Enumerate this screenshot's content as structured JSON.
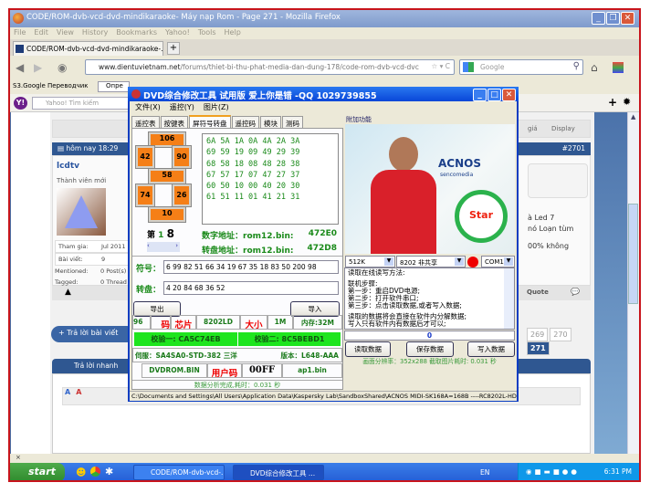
{
  "browser": {
    "title": "CODE/ROM-dvb-vcd-dvd-mindikaraoke- Máy nạp Rom - Page 271 - Mozilla Firefox",
    "menu": [
      "File",
      "Edit",
      "View",
      "History",
      "Bookmarks",
      "Yahoo!",
      "Tools",
      "Help"
    ],
    "tab": "CODE/ROM-dvb-vcd-dvd-mindikaraoke-...",
    "new_tab": "+",
    "url_domain": "www.dientuvietnam.net",
    "url_path": "/forums/thiet-bi-thu-phat-media-dan-dung-178/code-rom-dvb-vcd-dvc",
    "search_placeholder": "Google",
    "bookmark": "S3.Google Переводчик",
    "bookmark2": "Опре",
    "yahoo_logo": "Y!",
    "yahoo_search_placeholder": "Yahoo! Tìm kiếm",
    "status_x": "×"
  },
  "forum": {
    "post_time": "hôm nay 18:29",
    "post_number": "#2701",
    "username": "lcdtv",
    "rank": "Thành viên mới",
    "info": [
      {
        "label": "Tham gia:",
        "value": "Jul 2011"
      },
      {
        "label": "Bài viết:",
        "value": "9"
      },
      {
        "label": "Mentioned:",
        "value": "0 Post(s)"
      },
      {
        "label": "Tagged:",
        "value": "0 Thread"
      }
    ],
    "sort_label": "giá",
    "display_label": "Display",
    "text_lines": [
      "à Led 7",
      "nó Loạn tùm",
      "00% không"
    ],
    "quote": "Quote",
    "reply_button": "+ Trả lời bài viết",
    "quick_reply": "Trả lời nhanh",
    "pages": [
      "269",
      "270",
      "271"
    ],
    "current_page": "271"
  },
  "dvd": {
    "title": "DVD综合修改工具 试用版 爱上你是错 -QQ 1029739855",
    "menu": [
      "文件(X)",
      "遥控(Y)",
      "图片(Z)"
    ],
    "tabs": [
      "遥控表",
      "按键表",
      "屏符号转盘",
      "遥控码",
      "模块",
      "测码"
    ],
    "active_tab": 2,
    "buttons_orange": [
      "106",
      "42",
      "90",
      "58",
      "74",
      "26",
      "10"
    ],
    "hex_rows": [
      "6A 5A 1A 0A 4A 2A 3A",
      "69 59 19 09 49 29 39",
      "68 58 18 08 48 28 38",
      "67 57 17 07 47 27 37",
      "60 50 10 00 40 20 30",
      "61 51 11 01 41 21 31"
    ],
    "page_label": "第",
    "page_a": "1",
    "page_b": "8",
    "digit_addr_label": "数字地址：rom12.bin:",
    "digit_addr": "472E0",
    "disc_addr_label": "转盘地址：rom12.bin:",
    "disc_addr": "472D8",
    "symbol_label": "符号：",
    "symbol_value": "6 99 82 51 66 34 19 67 35 18 83 50 200 98",
    "disc_label": "转盘：",
    "disc_value": "4 20 84 68 36 52",
    "export": "导出",
    "import": "导入",
    "info_row": [
      "96",
      "码",
      "芯片",
      "8202LD",
      "大小",
      "1M",
      "内存:32M"
    ],
    "check1": "校验一: CA5C74EB",
    "check2": "校验二: 8C5BEBD1",
    "servo": "伺服：SA4SA0-STD-382 三洋",
    "version": "版本：L648-AAA",
    "rom_file": "DVDROM.BIN",
    "user_code_label": "用户码",
    "user_code": "00FF",
    "ap_file": "ap1.bin",
    "analysis": "数据分析完成,耗时：0.031 秒",
    "extra_label": "附加功能",
    "pic_brand": "ACNOS",
    "pic_brand_sub": "sencomedia",
    "pic_badge": "Star",
    "size_select": "512K",
    "chip_select": "8202 非共享",
    "com_select": "COM1",
    "notes": [
      "读取在线读写方法:",
      "",
      "联机步骤:",
      "第一步：重启DVD电源;",
      "第二步：打开软件串口;",
      "第三步：点击读取数据,或者写入数据;",
      "",
      "读取的数据将会直接在软件内分解数据;",
      "写入只有软件内有数据后才可以;"
    ],
    "progress": "0",
    "read": "读取数据",
    "save": "保存数据",
    "write": "写入数据",
    "resolution": "画面分辨率：352x288  截取图片耗时: 0.031 秒",
    "path": "C:\\Documents and Settings\\All Users\\Application Data\\Kaspersky Lab\\SandboxShared\\ACNOS MIDI-SK168A=168B ----RC8202L-HD"
  },
  "taskbar": {
    "start": "start",
    "tasks": [
      "CODE/ROM-dvb-vcd-...",
      "DVD综合修改工具 ..."
    ],
    "lang": "EN",
    "time": "6:31 PM"
  }
}
